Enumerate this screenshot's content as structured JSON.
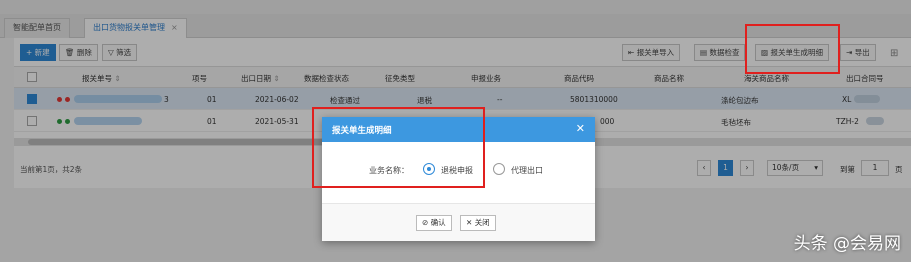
{
  "tabs": [
    {
      "label": "智能配单首页"
    },
    {
      "label": "出口货物报关单管理",
      "close": "×"
    }
  ],
  "toolbar": {
    "new_label": "+ 新建",
    "delete_label": "删除",
    "filter_label": "筛选",
    "import_label": "报关单导入",
    "check_label": "数据检查",
    "generate_label": "报关单生成明细",
    "export_label": "导出"
  },
  "grid": {
    "columns": [
      "报关单号",
      "项号",
      "出口日期",
      "数据检查状态",
      "征免类型",
      "申报业务",
      "商品代码",
      "商品名称",
      "海关商品名称",
      "出口合同号"
    ],
    "rows": [
      {
        "no_suffix": "3",
        "item": "01",
        "date": "2021-06-02",
        "status": "检查通过",
        "levy": "退税",
        "business": "--",
        "code": "5801310000",
        "name": "",
        "customs_name": "涤纶包边布",
        "contract": "XL"
      },
      {
        "no_suffix": "",
        "item": "01",
        "date": "2021-05-31",
        "status": "检",
        "levy": "",
        "business": "",
        "code": "000",
        "name": "",
        "customs_name": "毛毡坯布",
        "contract": "TZH-2"
      }
    ],
    "sort_icon": "⇕"
  },
  "footer": {
    "summary": "当前第1页，共2条",
    "page_current": "1",
    "page_size": "10条/页",
    "goto_label": "到第",
    "goto_value": "1",
    "page_suffix": "页"
  },
  "modal": {
    "title": "报关单生成明细",
    "field_label": "业务名称：",
    "options": [
      "退税申报",
      "代理出口"
    ],
    "selected": "退税申报",
    "confirm_label": "确认",
    "close_label": "关闭"
  },
  "watermark": "头条 @会易网",
  "colors": {
    "primary": "#2f8ad8",
    "modal_header": "#3d98e0",
    "highlight": "#e0201e"
  }
}
